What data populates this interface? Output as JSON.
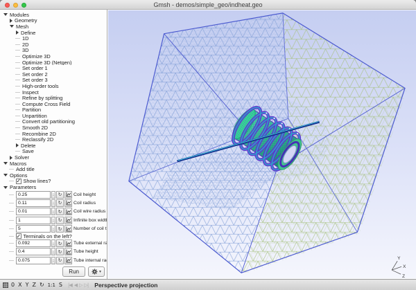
{
  "window": {
    "title": "Gmsh - demos/simple_geo/indheat.geo"
  },
  "sidebar": {
    "tree": [
      {
        "type": "branch",
        "depth": 0,
        "state": "expanded",
        "label": "Modules"
      },
      {
        "type": "branch",
        "depth": 1,
        "state": "collapsed",
        "label": "Geometry"
      },
      {
        "type": "branch",
        "depth": 1,
        "state": "expanded",
        "label": "Mesh"
      },
      {
        "type": "branch",
        "depth": 2,
        "state": "collapsed",
        "label": "Define"
      },
      {
        "type": "leaf",
        "depth": 2,
        "label": "1D"
      },
      {
        "type": "leaf",
        "depth": 2,
        "label": "2D"
      },
      {
        "type": "leaf",
        "depth": 2,
        "label": "3D"
      },
      {
        "type": "leaf",
        "depth": 2,
        "label": "Optimize 3D"
      },
      {
        "type": "leaf",
        "depth": 2,
        "label": "Optimize 3D (Netgen)"
      },
      {
        "type": "leaf",
        "depth": 2,
        "label": "Set order 1"
      },
      {
        "type": "leaf",
        "depth": 2,
        "label": "Set order 2"
      },
      {
        "type": "leaf",
        "depth": 2,
        "label": "Set order 3"
      },
      {
        "type": "leaf",
        "depth": 2,
        "label": "High-order tools"
      },
      {
        "type": "leaf",
        "depth": 2,
        "label": "Inspect"
      },
      {
        "type": "leaf",
        "depth": 2,
        "label": "Refine by splitting"
      },
      {
        "type": "leaf",
        "depth": 2,
        "label": "Compute Cross Field"
      },
      {
        "type": "leaf",
        "depth": 2,
        "label": "Partition"
      },
      {
        "type": "leaf",
        "depth": 2,
        "label": "Unpartition"
      },
      {
        "type": "leaf",
        "depth": 2,
        "label": "Convert old partitioning"
      },
      {
        "type": "leaf",
        "depth": 2,
        "label": "Smooth 2D"
      },
      {
        "type": "leaf",
        "depth": 2,
        "label": "Recombine 2D"
      },
      {
        "type": "leaf",
        "depth": 2,
        "label": "Reclassify 2D"
      },
      {
        "type": "branch",
        "depth": 2,
        "state": "collapsed",
        "label": "Delete"
      },
      {
        "type": "leaf",
        "depth": 2,
        "label": "Save"
      },
      {
        "type": "branch",
        "depth": 1,
        "state": "collapsed",
        "label": "Solver"
      },
      {
        "type": "branch",
        "depth": 0,
        "state": "expanded",
        "label": "Macros"
      },
      {
        "type": "leaf",
        "depth": 1,
        "label": "Add title"
      },
      {
        "type": "branch",
        "depth": 0,
        "state": "expanded",
        "label": "Options"
      },
      {
        "type": "checkbox",
        "depth": 1,
        "checked": true,
        "label": "Show lines?"
      },
      {
        "type": "branch",
        "depth": 0,
        "state": "expanded",
        "label": "Parameters"
      },
      {
        "type": "param",
        "depth": 1,
        "value": "0.25",
        "label": "Coil height"
      },
      {
        "type": "param",
        "depth": 1,
        "value": "0.11",
        "label": "Coil radius"
      },
      {
        "type": "param",
        "depth": 1,
        "value": "0.01",
        "label": "Coil wire radius"
      },
      {
        "type": "param",
        "depth": 1,
        "value": "1",
        "label": "Infinite box width"
      },
      {
        "type": "param",
        "depth": 1,
        "value": "5",
        "label": "Number of coil turns"
      },
      {
        "type": "checkbox",
        "depth": 1,
        "checked": true,
        "label": "Terminals on the left?"
      },
      {
        "type": "param",
        "depth": 1,
        "value": "0.092",
        "label": "Tube external radius"
      },
      {
        "type": "param",
        "depth": 1,
        "value": "0.4",
        "label": "Tube height"
      },
      {
        "type": "param",
        "depth": 1,
        "value": "0.075",
        "label": "Tube internal radius"
      }
    ],
    "run_button": "Run",
    "gear_caret": "▾"
  },
  "viewport": {
    "axes": {
      "x": "X",
      "y": "Y",
      "z": "Z"
    },
    "colors": {
      "background_top": "#c5cef1",
      "background_bottom": "#f5f6fd",
      "cube_edge": "#4c5bd0",
      "mesh_blue": "#7e9cd6",
      "mesh_green": "#a4bf78",
      "tube_teal": "#35b89a",
      "coil_purple": "#5e35cf",
      "coil_blue": "#2ea3c9",
      "rod_blue": "#16328f"
    }
  },
  "statusbar": {
    "view_buttons": [
      {
        "label": "0",
        "name": "reset-view-button"
      },
      {
        "label": "X",
        "name": "view-x-button"
      },
      {
        "label": "Y",
        "name": "view-y-button"
      },
      {
        "label": "Z",
        "name": "view-z-button"
      },
      {
        "label": "↻",
        "name": "rotate-view-button"
      },
      {
        "label": "1:1",
        "name": "zoom-one-to-one-button"
      },
      {
        "label": "S",
        "name": "snap-button"
      }
    ],
    "playback_buttons": [
      {
        "glyph": "|◀",
        "name": "rewind-button"
      },
      {
        "glyph": "◀",
        "name": "step-back-button"
      },
      {
        "glyph": "▷",
        "name": "play-button"
      },
      {
        "glyph": "▷|",
        "name": "step-forward-button"
      }
    ],
    "projection_label": "Perspective projection"
  }
}
